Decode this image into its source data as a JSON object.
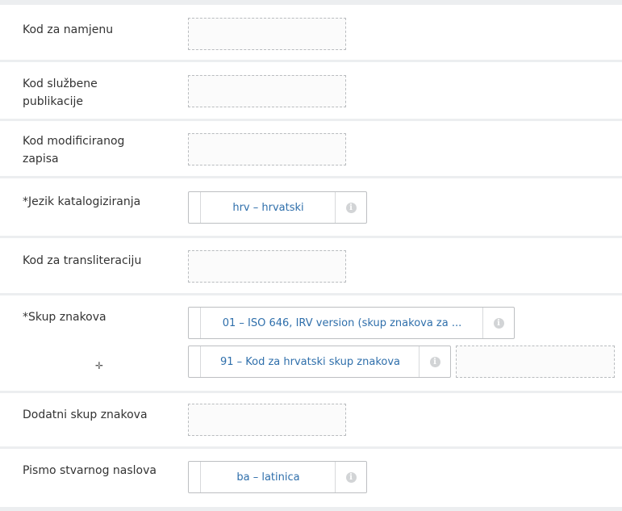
{
  "fields": {
    "kod_za_namjenu": {
      "label": "Kod za namjenu"
    },
    "kod_sluzbene_publikacije": {
      "label_line1": "Kod službene",
      "label_line2": "publikacije"
    },
    "kod_modificiranog_zapisa": {
      "label_line1": "Kod modificiranog",
      "label_line2": "zapisa"
    },
    "jezik_katalogiziranja": {
      "label": "*Jezik katalogiziranja",
      "value": "hrv – hrvatski"
    },
    "kod_za_transliteraciju": {
      "label": "Kod za transliteraciju"
    },
    "skup_znakova": {
      "label": "*Skup znakova",
      "value1": "01 – ISO 646, IRV version (skup znakova za ...",
      "value2": "91 – Kod za hrvatski skup znakova"
    },
    "dodatni_skup_znakova": {
      "label": "Dodatni skup znakova"
    },
    "pismo_stvarnog_naslova": {
      "label": "Pismo stvarnog naslova",
      "value": "ba – latinica"
    }
  },
  "icons": {
    "info": "info-icon",
    "cursor": "crosshair-cursor-icon"
  },
  "colors": {
    "value_text": "#2f6fab",
    "row_bg": "#ffffff",
    "separator": "#eceef0",
    "info_icon": "#d2d4d6"
  }
}
